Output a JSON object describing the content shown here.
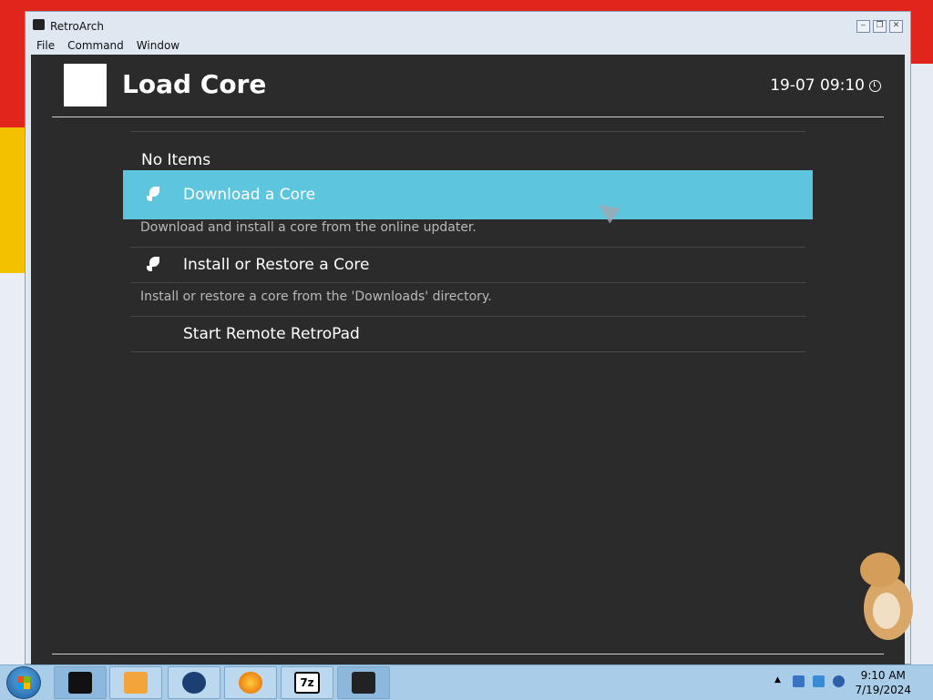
{
  "window": {
    "title": "RetroArch",
    "controls": [
      "minimize",
      "restore",
      "close"
    ]
  },
  "menubar": [
    "File",
    "Command",
    "Window"
  ],
  "header": {
    "title": "Load Core",
    "datetime": "19-07 09:10"
  },
  "menu": {
    "no_items": "No Items",
    "items": [
      {
        "label": "Download a Core",
        "description": "Download and install a core from the online updater.",
        "icon": "rocket-icon",
        "selected": true
      },
      {
        "label": "Install or Restore a Core",
        "description": "Install or restore a core from the 'Downloads' directory.",
        "icon": "rocket-icon",
        "selected": false
      },
      {
        "label": "Start Remote RetroPad",
        "description": "",
        "icon": "gamepad-icon",
        "selected": false
      }
    ]
  },
  "taskbar": {
    "apps": [
      "terminal-icon",
      "media-player-icon",
      "globe-icon",
      "firefox-icon",
      "7zip-icon",
      "retroarch-icon"
    ],
    "sevenzip_label": "7z",
    "time": "9:10 AM",
    "date": "7/19/2024"
  },
  "colors": {
    "accent": "#5ec5de",
    "background": "#2b2b2b"
  }
}
